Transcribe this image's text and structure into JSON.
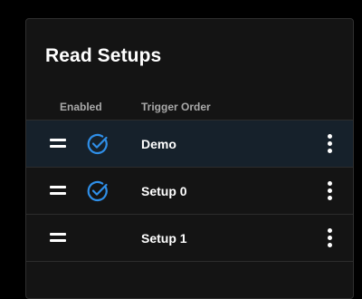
{
  "panel": {
    "title": "Read Setups",
    "columns": {
      "enabled": "Enabled",
      "trigger_order": "Trigger Order"
    },
    "rows": [
      {
        "name": "Demo",
        "enabled": true,
        "selected": true
      },
      {
        "name": "Setup 0",
        "enabled": true,
        "selected": false
      },
      {
        "name": "Setup 1",
        "enabled": false,
        "selected": false
      }
    ]
  },
  "colors": {
    "background": "#000000",
    "panel": "#141414",
    "selected_row": "#16212b",
    "accent": "#2f8fe8",
    "text": "#ffffff",
    "muted_text": "#a9a9a9"
  },
  "icons": {
    "drag_handle": "drag-handle-icon",
    "enabled": "check-circle-icon",
    "row_menu": "more-vertical-icon"
  }
}
